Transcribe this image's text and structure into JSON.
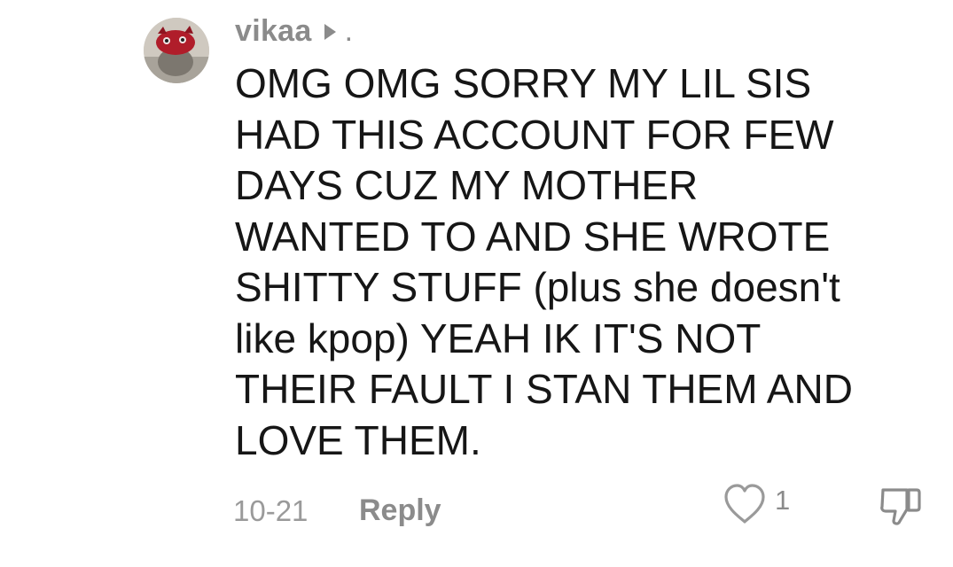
{
  "comment": {
    "username": "vikaa",
    "username_suffix": ".",
    "text": "OMG OMG SORRY MY LIL SIS\nHAD THIS ACCOUNT FOR FEW\nDAYS CUZ MY MOTHER\nWANTED TO AND SHE WROTE\nSHITTY STUFF (plus she doesn't\nlike kpop) YEAH IK IT'S NOT\nTHEIR FAULT I STAN THEM AND\nLOVE THEM.",
    "date": "10-21",
    "reply_label": "Reply",
    "like_count": "1",
    "icons": {
      "avatar": "avatar-image",
      "play": "play-icon",
      "like": "heart-icon",
      "dislike": "thumbs-down-icon"
    }
  }
}
